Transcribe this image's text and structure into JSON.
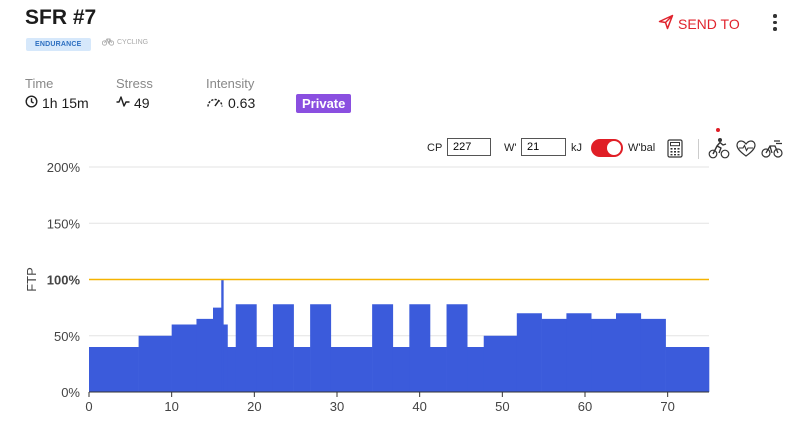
{
  "workout": {
    "title": "SFR #7",
    "tag": "ENDURANCE",
    "sport": "CYCLING"
  },
  "header": {
    "send_label": "SEND TO"
  },
  "metrics": {
    "time_label": "Time",
    "time_value": "1h 15m",
    "stress_label": "Stress",
    "stress_value": "49",
    "intensity_label": "Intensity",
    "intensity_value": "0.63",
    "privacy_badge": "Private"
  },
  "controls": {
    "cp_label": "CP",
    "cp_value": "227",
    "w_label": "W'",
    "w_value": "21",
    "w_unit": "kJ",
    "wbal_label": "W'bal",
    "wbal_enabled": true
  },
  "colors": {
    "bars": "#3b5bdb",
    "ftp_line": "#f5b301",
    "accent_red": "#e01e26",
    "private_badge": "#8a4fe0"
  },
  "chart_data": {
    "type": "area",
    "ylabel": "FTP",
    "xlabel": "",
    "xlim": [
      0,
      75
    ],
    "ylim": [
      0,
      200
    ],
    "x_ticks": [
      "0",
      "10",
      "20",
      "30",
      "40",
      "50",
      "60",
      "70"
    ],
    "y_ticks": [
      "0%",
      "50%",
      "100%",
      "150%",
      "200%"
    ],
    "reference_line": {
      "value": 100,
      "label": "100%"
    },
    "segments": [
      {
        "start": 0,
        "end": 6,
        "power": 40
      },
      {
        "start": 6,
        "end": 10,
        "power": 50
      },
      {
        "start": 10,
        "end": 13,
        "power": 60
      },
      {
        "start": 13,
        "end": 15,
        "power": 65
      },
      {
        "start": 15,
        "end": 16,
        "power": 75
      },
      {
        "start": 16,
        "end": 16.25,
        "power": 100
      },
      {
        "start": 16.25,
        "end": 16.75,
        "power": 60
      },
      {
        "start": 16.75,
        "end": 17.75,
        "power": 40
      },
      {
        "start": 17.75,
        "end": 20.25,
        "power": 78
      },
      {
        "start": 20.25,
        "end": 22.25,
        "power": 40
      },
      {
        "start": 22.25,
        "end": 24.75,
        "power": 78
      },
      {
        "start": 24.75,
        "end": 26.75,
        "power": 40
      },
      {
        "start": 26.75,
        "end": 29.25,
        "power": 78
      },
      {
        "start": 29.25,
        "end": 34.25,
        "power": 40
      },
      {
        "start": 34.25,
        "end": 36.75,
        "power": 78
      },
      {
        "start": 36.75,
        "end": 38.75,
        "power": 40
      },
      {
        "start": 38.75,
        "end": 41.25,
        "power": 78
      },
      {
        "start": 41.25,
        "end": 43.25,
        "power": 40
      },
      {
        "start": 43.25,
        "end": 45.75,
        "power": 78
      },
      {
        "start": 45.75,
        "end": 47.75,
        "power": 40
      },
      {
        "start": 47.75,
        "end": 51.75,
        "power": 50
      },
      {
        "start": 51.75,
        "end": 54.75,
        "power": 70
      },
      {
        "start": 54.75,
        "end": 57.75,
        "power": 65
      },
      {
        "start": 57.75,
        "end": 60.75,
        "power": 70
      },
      {
        "start": 60.75,
        "end": 63.75,
        "power": 65
      },
      {
        "start": 63.75,
        "end": 66.75,
        "power": 70
      },
      {
        "start": 66.75,
        "end": 69.75,
        "power": 65
      },
      {
        "start": 69.75,
        "end": 75,
        "power": 40
      }
    ]
  }
}
